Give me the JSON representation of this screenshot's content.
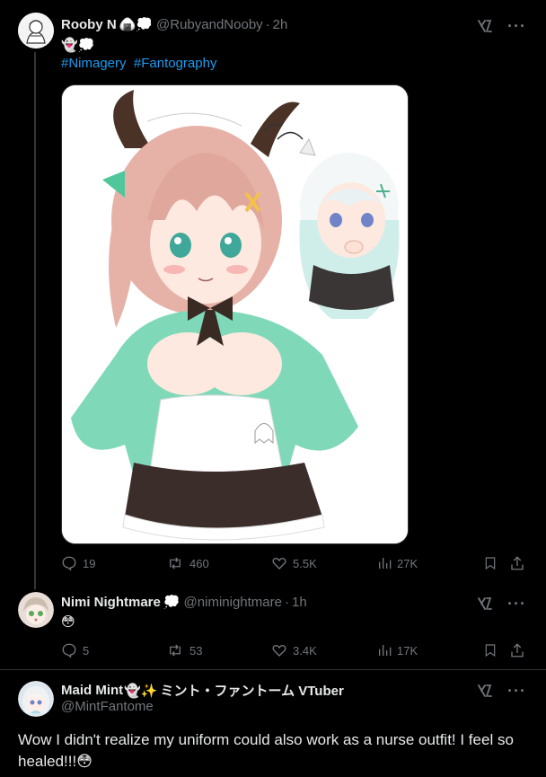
{
  "posts": [
    {
      "name": "Rooby N",
      "name_emoji": "🍙💭",
      "handle": "@RubyandNooby",
      "time": "2h",
      "text_emoji": "👻💭",
      "hashtags": [
        "#Nimagery",
        "#Fantography"
      ],
      "stats": {
        "replies": "19",
        "reposts": "460",
        "likes": "5.5K",
        "views": "27K"
      }
    },
    {
      "name": "Nimi Nightmare",
      "name_emoji": "💭",
      "handle": "@niminightmare",
      "time": "1h",
      "text": "😳",
      "stats": {
        "replies": "5",
        "reposts": "53",
        "likes": "3.4K",
        "views": "17K"
      }
    },
    {
      "name": "Maid Mint",
      "name_emoji": "👻✨",
      "name_suffix": "ミント・ファントーム VTuber",
      "handle": "@MintFantome",
      "text": "Wow I didn't realize my uniform could also work as a nurse outfit! I feel so healed!!!😳"
    }
  ],
  "more_label": "···",
  "colors": {
    "background": "#000000",
    "text": "#e7e9ea",
    "muted": "#71767b",
    "link": "#1d9bf0",
    "border": "#2f3336"
  }
}
